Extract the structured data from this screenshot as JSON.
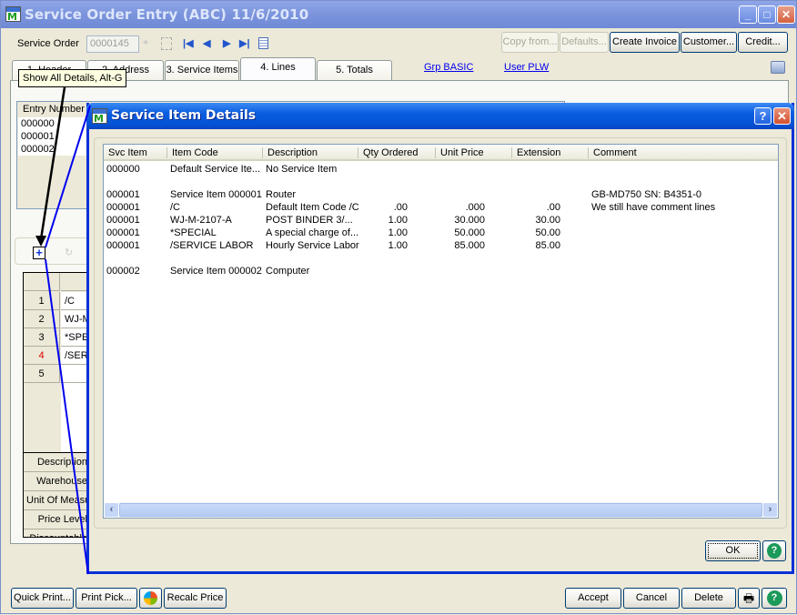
{
  "main_window": {
    "title": "Service Order Entry (ABC) 11/6/2010",
    "controls": {
      "minimize": "_",
      "maximize": "□",
      "close": "✕"
    }
  },
  "header": {
    "service_order_label": "Service Order",
    "service_order_value": "0000145",
    "buttons": {
      "copy_from": "Copy from...",
      "defaults": "Defaults...",
      "create_invoice": "Create Invoice",
      "customer": "Customer...",
      "credit": "Credit..."
    }
  },
  "tabs": [
    {
      "label": "1. Header"
    },
    {
      "label": "2. Address"
    },
    {
      "label": "3. Service Items"
    },
    {
      "label": "4. Lines",
      "active": true
    },
    {
      "label": "5. Totals"
    }
  ],
  "links": {
    "group": "Grp BASIC",
    "user": "User PLW"
  },
  "tooltip": "Show All Details, Alt-G",
  "entry_list": {
    "header": "Entry Number",
    "rows": [
      "000000",
      "000001",
      "000002"
    ]
  },
  "lines_grid": {
    "rows": [
      {
        "num": "1",
        "item": "/C"
      },
      {
        "num": "2",
        "item": "WJ-M"
      },
      {
        "num": "3",
        "item": "*SPEC"
      },
      {
        "num": "4",
        "item": "/SERV",
        "highlight": true
      },
      {
        "num": "5",
        "item": ""
      }
    ],
    "properties": [
      "Description",
      "Warehouse",
      "Unit Of Measure",
      "Price Level",
      "Discountable"
    ]
  },
  "footer_buttons": {
    "quick_print": "Quick Print...",
    "print_pick": "Print Pick...",
    "recalc_price": "Recalc Price",
    "accept": "Accept",
    "cancel": "Cancel",
    "delete": "Delete"
  },
  "dialog": {
    "title": "Service Item Details",
    "columns": [
      "Svc Item",
      "Item Code",
      "Description",
      "Qty Ordered",
      "Unit Price",
      "Extension",
      "Comment"
    ],
    "rows": [
      {
        "svc_item": "000000",
        "item_code": "Default Service Ite...",
        "description": "No Service Item",
        "qty": "",
        "unit_price": "",
        "extension": "",
        "comment": ""
      },
      {
        "svc_item": "",
        "item_code": "",
        "description": "",
        "qty": "",
        "unit_price": "",
        "extension": "",
        "comment": ""
      },
      {
        "svc_item": "000001",
        "item_code": "Service Item 000001",
        "description": "Router",
        "qty": "",
        "unit_price": "",
        "extension": "",
        "comment": "GB-MD750 SN:  B4351-0"
      },
      {
        "svc_item": "000001",
        "item_code": "/C",
        "description": "Default Item Code /C",
        "qty": ".00",
        "unit_price": ".000",
        "extension": ".00",
        "comment": "We still have comment lines"
      },
      {
        "svc_item": "000001",
        "item_code": "WJ-M-2107-A",
        "description": "POST BINDER 3/...",
        "qty": "1.00",
        "unit_price": "30.000",
        "extension": "30.00",
        "comment": ""
      },
      {
        "svc_item": "000001",
        "item_code": "*SPECIAL",
        "description": "A special charge of...",
        "qty": "1.00",
        "unit_price": "50.000",
        "extension": "50.00",
        "comment": ""
      },
      {
        "svc_item": "000001",
        "item_code": "/SERVICE LABOR",
        "description": "Hourly Service Labor",
        "qty": "1.00",
        "unit_price": "85.000",
        "extension": "85.00",
        "comment": ""
      },
      {
        "svc_item": "",
        "item_code": "",
        "description": "",
        "qty": "",
        "unit_price": "",
        "extension": "",
        "comment": ""
      },
      {
        "svc_item": "000002",
        "item_code": "Service Item 000002",
        "description": "Computer",
        "qty": "",
        "unit_price": "",
        "extension": "",
        "comment": ""
      }
    ],
    "ok_label": "OK"
  }
}
